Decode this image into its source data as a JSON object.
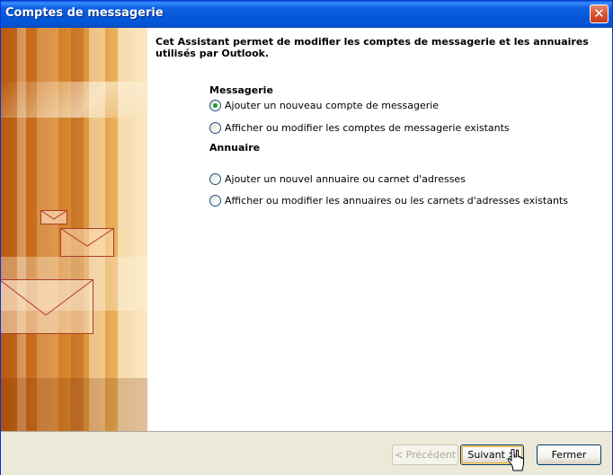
{
  "window": {
    "title": "Comptes de messagerie",
    "close_icon": "close-icon"
  },
  "intro": "Cet Assistant permet de modifier les comptes de messagerie et les annuaires utilisés par Outlook.",
  "messagerie": {
    "label": "Messagerie",
    "options": [
      {
        "label": "Ajouter un nouveau compte de messagerie",
        "checked": true
      },
      {
        "label": "Afficher ou modifier les comptes de messagerie existants",
        "checked": false
      }
    ]
  },
  "annuaire": {
    "label": "Annuaire",
    "options": [
      {
        "label": "Ajouter un nouvel annuaire ou carnet d'adresses",
        "checked": false
      },
      {
        "label": "Afficher ou modifier les annuaires ou les carnets d'adresses existants",
        "checked": false
      }
    ]
  },
  "buttons": {
    "previous": "< Précédent",
    "next": "Suivant >",
    "close": "Fermer"
  },
  "colors": {
    "titlebar": "#0456D8",
    "dialog_bg": "#ECE9D8",
    "accent_orange": "#D07A22"
  }
}
